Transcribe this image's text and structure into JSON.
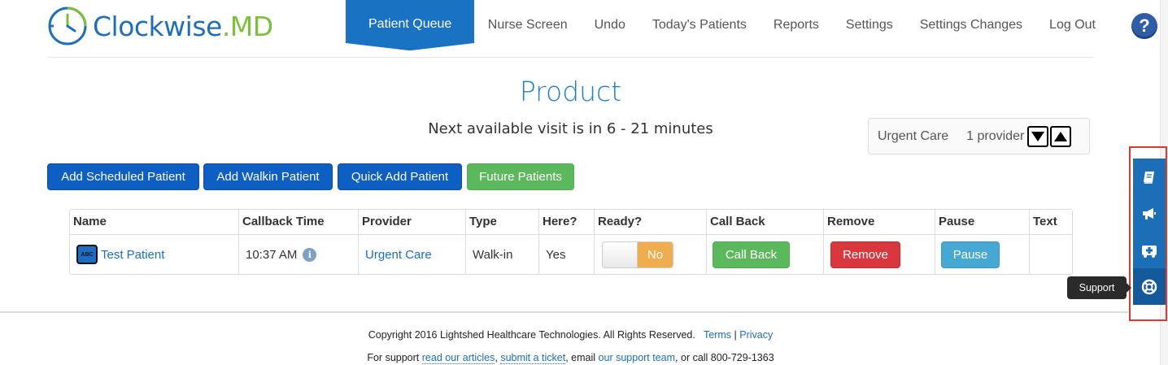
{
  "app": {
    "logo_text": "Clockwise",
    "logo_suffix": ".MD",
    "brand_blue": "#1f6fb8",
    "brand_green": "#7bbf3a"
  },
  "nav": {
    "items": [
      {
        "label": "Patient Queue",
        "active": true
      },
      {
        "label": "Nurse Screen"
      },
      {
        "label": "Undo"
      },
      {
        "label": "Today's Patients"
      },
      {
        "label": "Reports"
      },
      {
        "label": "Settings"
      },
      {
        "label": "Settings Changes"
      },
      {
        "label": "Log Out"
      }
    ],
    "help_label": "?"
  },
  "page": {
    "title": "Product",
    "subtitle": "Next available visit is in 6 - 21 minutes"
  },
  "provider_box": {
    "location": "Urgent Care",
    "count": "1 provider"
  },
  "actions": {
    "add_scheduled": "Add Scheduled Patient",
    "add_walkin": "Add Walkin Patient",
    "quick_add": "Quick Add Patient",
    "future": "Future Patients"
  },
  "table": {
    "headers": [
      "Name",
      "Callback Time",
      "Provider",
      "Type",
      "Here?",
      "Ready?",
      "Call Back",
      "Remove",
      "Pause",
      "Text"
    ],
    "rows": [
      {
        "icon_text": "ABC",
        "name": "Test Patient",
        "callback_time": "10:37 AM",
        "info_glyph": "i",
        "provider": "Urgent Care",
        "type": "Walk-in",
        "here": "Yes",
        "ready": "No",
        "call_back": "Call Back",
        "remove": "Remove",
        "pause": "Pause",
        "text": ""
      }
    ]
  },
  "footer": {
    "copyright": "Copyright 2016 Lightshed Healthcare Technologies. All Rights Reserved.",
    "terms": "Terms",
    "separator": "|",
    "privacy": "Privacy",
    "support_prefix": "For support",
    "read_articles": "read our articles",
    "comma": ",",
    "submit_ticket": "submit a ticket",
    "email_text": ", email",
    "support_team": "our support team",
    "call_text": ", or call 800-729-1363"
  },
  "dock": {
    "items": [
      {
        "icon": "book-icon"
      },
      {
        "icon": "megaphone-icon"
      },
      {
        "icon": "first-aid-icon"
      },
      {
        "icon": "life-ring-icon",
        "active": true
      }
    ],
    "tooltip": "Support"
  }
}
